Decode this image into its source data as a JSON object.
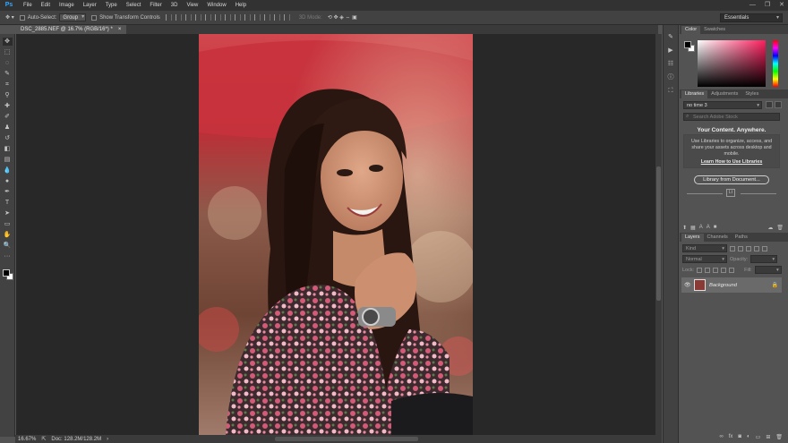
{
  "app": {
    "logo": "Ps"
  },
  "menu": [
    "File",
    "Edit",
    "Image",
    "Layer",
    "Type",
    "Select",
    "Filter",
    "3D",
    "View",
    "Window",
    "Help"
  ],
  "window_controls": [
    "—",
    "❐",
    "✕"
  ],
  "options_bar": {
    "auto_select_label": "Auto-Select:",
    "auto_select_value": "Group",
    "transform_label": "Show Transform Controls",
    "mode_3d_label": "3D Mode:",
    "workspace": "Essentials"
  },
  "document": {
    "tab_title": "DSC_2885.NEF @ 16.7% (RGB/16*) *",
    "close_glyph": "×"
  },
  "status": {
    "zoom": "16.67%",
    "doc_info": "Doc: 128.2M/128.2M",
    "arrow": "›"
  },
  "tools": [
    {
      "name": "move-tool",
      "glyph": "✥"
    },
    {
      "name": "marquee-tool",
      "glyph": "⬚"
    },
    {
      "name": "lasso-tool",
      "glyph": "◌"
    },
    {
      "name": "quick-select-tool",
      "glyph": "✎"
    },
    {
      "name": "crop-tool",
      "glyph": "⌗"
    },
    {
      "name": "eyedropper-tool",
      "glyph": "⚲"
    },
    {
      "name": "healing-tool",
      "glyph": "✚"
    },
    {
      "name": "brush-tool",
      "glyph": "✐"
    },
    {
      "name": "clone-stamp-tool",
      "glyph": "♟"
    },
    {
      "name": "history-brush-tool",
      "glyph": "↺"
    },
    {
      "name": "eraser-tool",
      "glyph": "◧"
    },
    {
      "name": "gradient-tool",
      "glyph": "▤"
    },
    {
      "name": "blur-tool",
      "glyph": "💧"
    },
    {
      "name": "dodge-tool",
      "glyph": "●"
    },
    {
      "name": "pen-tool",
      "glyph": "✒"
    },
    {
      "name": "type-tool",
      "glyph": "T"
    },
    {
      "name": "path-select-tool",
      "glyph": "➤"
    },
    {
      "name": "shape-tool",
      "glyph": "▭"
    },
    {
      "name": "hand-tool",
      "glyph": "✋"
    },
    {
      "name": "zoom-tool",
      "glyph": "🔍"
    },
    {
      "name": "more-tools",
      "glyph": "···"
    }
  ],
  "color_panel": {
    "tabs": [
      "Color",
      "Swatches"
    ]
  },
  "libraries_panel": {
    "tabs": [
      "Libraries",
      "Adjustments",
      "Styles"
    ],
    "library_select": "no time 3",
    "search_placeholder": "Search Adobe Stock",
    "headline": "Your Content. Anywhere.",
    "description": "Use Libraries to organize, access, and share your assets across desktop and mobile.",
    "link": "Learn How to Use Libraries",
    "button": "Library from Document...",
    "center_icon": "Lt"
  },
  "layers_panel": {
    "tabs": [
      "Layers",
      "Channels",
      "Paths"
    ],
    "filter_placeholder": "Kind",
    "blend_mode": "Normal",
    "opacity_label": "Opacity:",
    "lock_label": "Lock:",
    "fill_label": "Fill:",
    "layer_name": "Background",
    "eye_glyph": "👁",
    "lock_glyph": "🔒"
  }
}
